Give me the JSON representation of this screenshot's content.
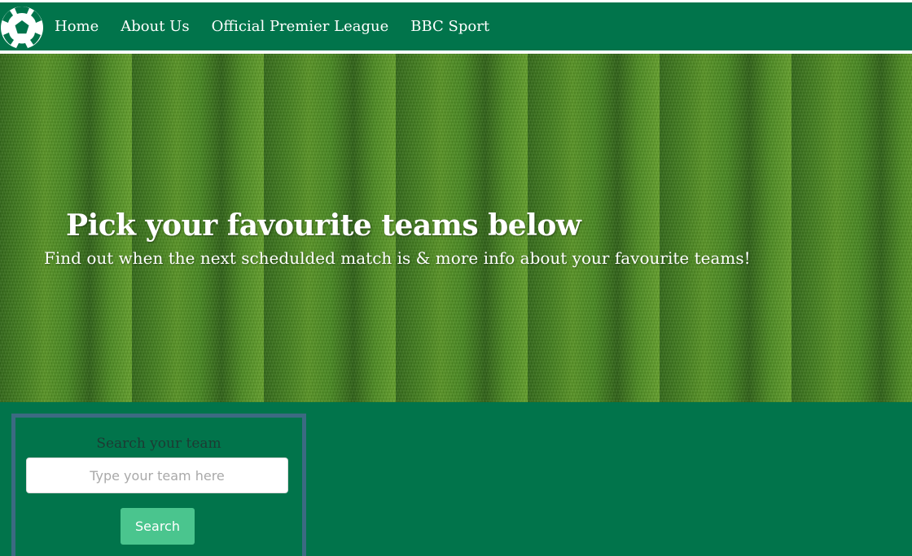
{
  "nav": {
    "logo_icon": "soccer-ball-icon",
    "items": [
      {
        "label": "Home"
      },
      {
        "label": "About Us"
      },
      {
        "label": "Official Premier League"
      },
      {
        "label": "BBC Sport"
      }
    ]
  },
  "hero": {
    "title": "Pick your favourite teams below",
    "subtitle": "Find out when the next schedulded match is & more info about your favourite teams!"
  },
  "search": {
    "heading": "Search your team",
    "placeholder": "Type your team here",
    "value": "",
    "button_label": "Search"
  },
  "colors": {
    "brand_green": "#01744b",
    "panel_border": "#3c6a82",
    "button": "#4ac58e"
  }
}
